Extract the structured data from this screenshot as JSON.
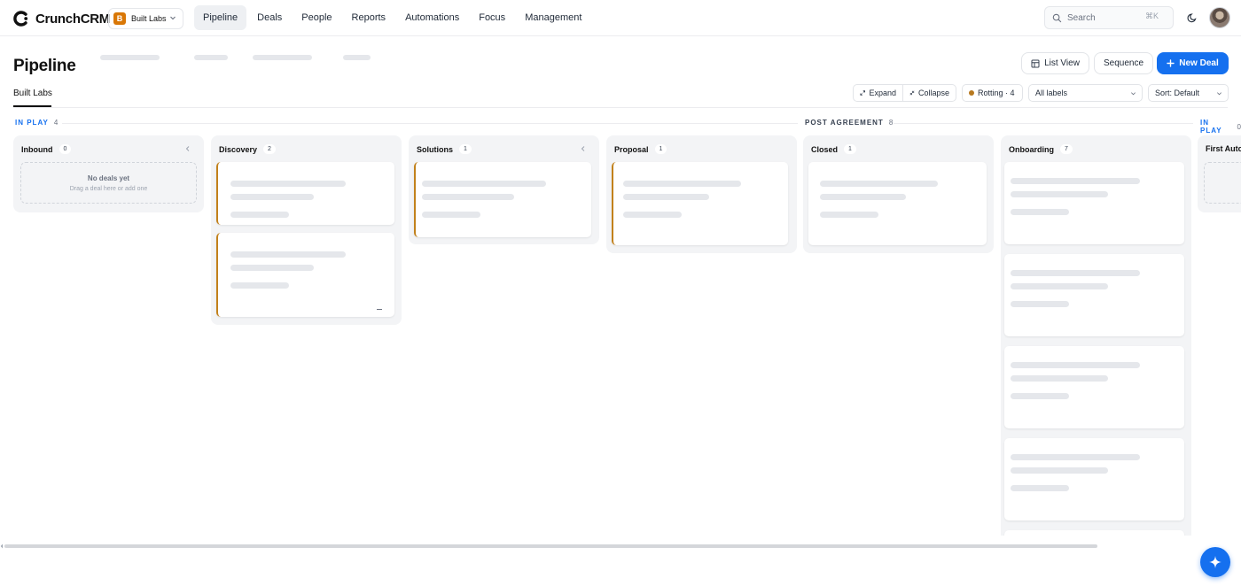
{
  "brand": {
    "name": "CrunchCRM"
  },
  "workspace": {
    "initial": "B",
    "name": "Built Labs"
  },
  "nav": {
    "items": [
      {
        "label": "Pipeline",
        "active": true
      },
      {
        "label": "Deals"
      },
      {
        "label": "People"
      },
      {
        "label": "Reports"
      },
      {
        "label": "Automations"
      },
      {
        "label": "Focus"
      },
      {
        "label": "Management"
      }
    ]
  },
  "search": {
    "placeholder": "Search",
    "shortcut": "⌘K"
  },
  "header": {
    "title": "Pipeline",
    "list_view_label": "List View",
    "sequence_label": "Sequence",
    "new_deal_label": "New Deal"
  },
  "subnav": {
    "active_tab": "Built Labs"
  },
  "toolbar": {
    "expand_label": "Expand",
    "collapse_label": "Collapse",
    "rotting_label": "Rotting · 4",
    "labels_select": "All labels",
    "sort_select": "Sort: Default"
  },
  "sections": [
    {
      "label": "IN PLAY",
      "count": "4"
    },
    {
      "label": "POST AGREEMENT",
      "count": "8"
    },
    {
      "label": "IN PLAY",
      "count": "0"
    }
  ],
  "columns": [
    {
      "name": "Inbound",
      "count": "0",
      "empty_title": "No deals yet",
      "empty_sub": "Drag a deal here or add one"
    },
    {
      "name": "Discovery",
      "count": "2"
    },
    {
      "name": "Solutions",
      "count": "1"
    },
    {
      "name": "Proposal",
      "count": "1"
    },
    {
      "name": "Closed",
      "count": "1"
    },
    {
      "name": "Onboarding",
      "count": "7"
    },
    {
      "name": "First Auto",
      "count": ""
    }
  ],
  "colors": {
    "accent": "#1570ef",
    "rotting": "#c2811b",
    "workspace_badge": "#d97706"
  }
}
